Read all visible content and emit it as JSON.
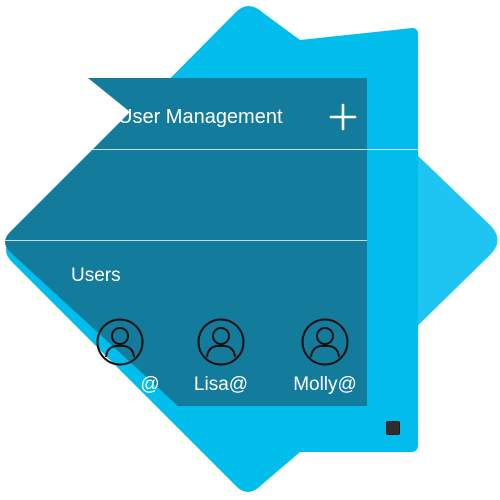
{
  "header": {
    "title": "User Management",
    "icon": "users-icon",
    "add_icon": "plus-icon"
  },
  "section": {
    "label": "Users"
  },
  "users": [
    {
      "name": "@",
      "icon": "user-avatar-icon"
    },
    {
      "name": "Lisa@",
      "icon": "user-avatar-icon"
    },
    {
      "name": "Molly@",
      "icon": "user-avatar-icon"
    }
  ],
  "colors": {
    "diamond": "#00BDEB",
    "diamond_right": "#1FC5F2",
    "panel": "#137C9C",
    "text": "#FFFFFF",
    "handle": "#2D2D2D"
  }
}
